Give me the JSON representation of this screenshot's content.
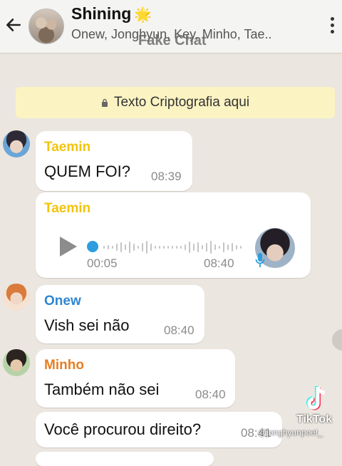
{
  "header": {
    "title": "Shining",
    "title_emoji": "🌟",
    "members": "Onew, Jonghyun, Key, Minho, Tae..",
    "overlay_label": "Fake Chat"
  },
  "encryption_notice": "Texto Criptografia aqui",
  "messages": [
    {
      "sender": "Taemin",
      "sender_color": "#f1c40f",
      "text": "QUEM FOI?",
      "time": "08:39"
    },
    {
      "sender": "Taemin",
      "sender_color": "#f1c40f",
      "voice_elapsed": "00:05",
      "voice_time": "08:40"
    },
    {
      "sender": "Onew",
      "sender_color": "#2e86d4",
      "text": "Vish sei não",
      "time": "08:40"
    },
    {
      "sender": "Minho",
      "sender_color": "#e67e22",
      "text": "Também não sei",
      "time": "08:40"
    },
    {
      "text": "Você procurou direito?",
      "time": "08:41"
    }
  ],
  "watermark": {
    "brand": "TikTok",
    "user": "@jonghyunpoet_"
  },
  "colors": {
    "accent_blue": "#2c9ddf",
    "background": "#ebe6df",
    "notice_bg": "#fbf3c2"
  }
}
